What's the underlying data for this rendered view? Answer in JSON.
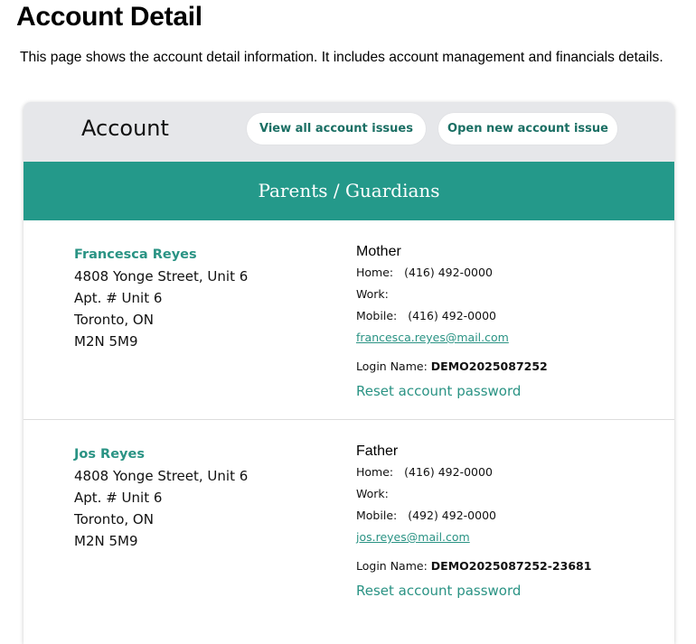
{
  "page": {
    "title": "Account Detail",
    "description": "This page shows the account detail information. It includes account management and financials details."
  },
  "account": {
    "heading": "Account",
    "view_issues_label": "View all account issues",
    "open_issue_label": "Open new account issue"
  },
  "section": {
    "title": "Parents / Guardians"
  },
  "guardians": [
    {
      "name": "Francesca Reyes",
      "address": [
        "4808 Yonge Street, Unit 6",
        "Apt. # Unit 6",
        "Toronto, ON",
        "M2N 5M9"
      ],
      "relation": "Mother",
      "home_label": "Home:",
      "home": "(416) 492-0000",
      "work_label": "Work:",
      "work": "",
      "mobile_label": "Mobile:",
      "mobile": "(416) 492-0000",
      "email": "francesca.reyes@mail.com",
      "login_label": "Login Name:",
      "login": "DEMO2025087252",
      "reset_label": "Reset account password"
    },
    {
      "name": "Jos Reyes",
      "address": [
        "4808 Yonge Street, Unit 6",
        "Apt. # Unit 6",
        "Toronto, ON",
        "M2N 5M9"
      ],
      "relation": "Father",
      "home_label": "Home:",
      "home": "(416) 492-0000",
      "work_label": "Work:",
      "work": "",
      "mobile_label": "Mobile:",
      "mobile": "(492) 492-0000",
      "email": "jos.reyes@mail.com",
      "login_label": "Login Name:",
      "login": "DEMO2025087252-23681",
      "reset_label": "Reset account password"
    }
  ],
  "colors": {
    "accent": "#24998a",
    "link": "#2a9384",
    "header_bg": "#e6e7ea"
  }
}
